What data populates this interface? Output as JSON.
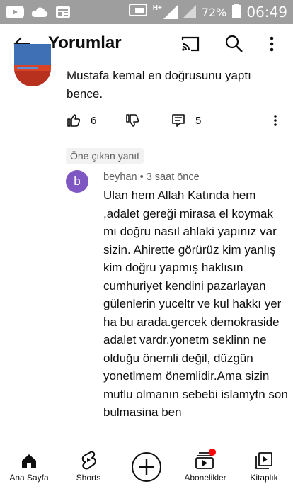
{
  "status_bar": {
    "network": "H+",
    "battery": "72%",
    "time": "06:49"
  },
  "app_bar": {
    "title": "Yorumlar",
    "icons": [
      "back-arrow-icon",
      "cast-icon",
      "search-icon",
      "more-vert-icon"
    ]
  },
  "parent_comment": {
    "text": "Mustafa kemal en doğrusunu yaptı bence.",
    "likes": "6",
    "replies": "5"
  },
  "pinned_label": "Öne çıkan yanıt",
  "reply": {
    "avatar_letter": "b",
    "author": "beyhan",
    "separator": "•",
    "time": "3 saat önce",
    "text": "Ulan  hem Allah  Katında hem ,adalet gereği mirasa el koymak mı doğru nasıl ahlaki yapınız var sizin. Ahirette görürüz kim yanlış kim doğru yapmış haklısın cumhuriyet kendini pazarlayan gülenlerin yuceltr ve kul hakkı yer ha bu arada.gercek demokraside adalet vardr.yonetm seklinn ne olduğu önemli değil, düzgün yonetlmem önemlidir.Ama sizin mutlu olmanın sebebi islamytn son bulmasina ben"
  },
  "colors": {
    "accent_purple": "#7e57c2",
    "status_bar": "#9e9e9e",
    "notification_dot": "#ff0000"
  },
  "bottom_nav": [
    {
      "label": "Ana Sayfa",
      "icon": "home-icon"
    },
    {
      "label": "Shorts",
      "icon": "shorts-icon"
    },
    {
      "label": "",
      "icon": "create-plus-icon"
    },
    {
      "label": "Abonelikler",
      "icon": "subscriptions-icon"
    },
    {
      "label": "Kitaplık",
      "icon": "library-icon"
    }
  ]
}
